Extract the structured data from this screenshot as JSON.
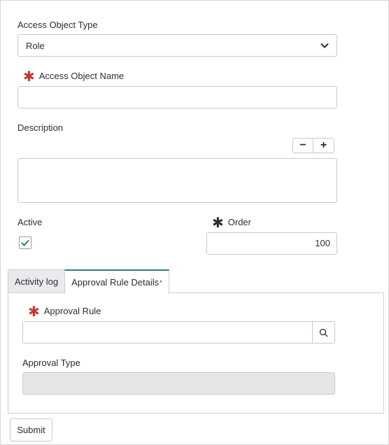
{
  "form": {
    "access_object_type": {
      "label": "Access Object Type",
      "value": "Role"
    },
    "access_object_name": {
      "label": "Access Object Name",
      "value": "",
      "required_mark": "✱"
    },
    "description": {
      "label": "Description",
      "value": "",
      "minus": "−",
      "plus": "+"
    },
    "active": {
      "label": "Active",
      "checked": true
    },
    "order": {
      "label": "Order",
      "value": "100",
      "required_mark": "✱"
    }
  },
  "tabs": [
    {
      "label": "Activity log",
      "active": false
    },
    {
      "label": "Approval Rule Details",
      "active": true,
      "modified_mark": "*"
    }
  ],
  "approval": {
    "approval_rule": {
      "label": "Approval Rule",
      "value": "",
      "required_mark": "✱"
    },
    "approval_type": {
      "label": "Approval Type",
      "value": ""
    }
  },
  "actions": {
    "submit_label": "Submit"
  },
  "colors": {
    "required": "#c8372f",
    "tab_accent": "#2a7e7a",
    "check": "#2a7e7a",
    "readonly_bg": "#e5e6e7"
  },
  "icons": {
    "select_chevron": "chevron-down-icon",
    "lookup": "search-icon",
    "checkbox": "check-icon"
  }
}
